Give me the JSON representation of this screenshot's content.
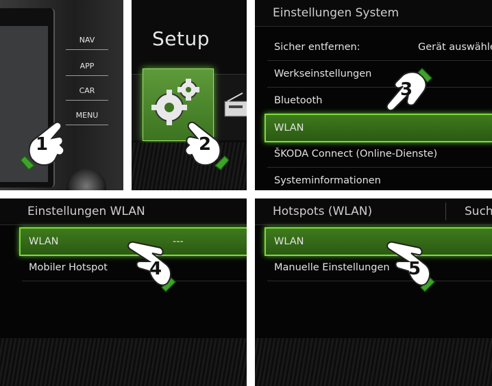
{
  "panel_dashboard": {
    "buttons": [
      "NAV",
      "APP",
      "CAR",
      "MENU"
    ],
    "step": "1"
  },
  "panel_setup": {
    "title": "Setup",
    "step": "2"
  },
  "panel_system": {
    "title": "Einstellungen System",
    "rows": [
      {
        "label": "Sicher entfernen:",
        "value": "Gerät auswähle"
      },
      {
        "label": "Werkseinstellungen"
      },
      {
        "label": "Bluetooth"
      },
      {
        "label": "WLAN",
        "selected": true
      },
      {
        "label": "ŠKODA Connect (Online-Dienste)"
      },
      {
        "label": "Systeminformationen"
      }
    ],
    "step": "3"
  },
  "panel_wlan": {
    "title": "Einstellungen WLAN",
    "rows": [
      {
        "label": "WLAN",
        "value": "---",
        "selected": true
      },
      {
        "label": "Mobiler Hotspot"
      }
    ],
    "step": "4"
  },
  "panel_hotspots": {
    "title": "Hotspots (WLAN)",
    "title_action": "Such",
    "rows": [
      {
        "label": "WLAN",
        "selected": true
      },
      {
        "label": "Manuelle Einstellungen"
      }
    ],
    "step": "5"
  },
  "colors": {
    "highlight_green": "#3f7a1e",
    "highlight_border": "#7ddc3a",
    "hand_green": "#3fa32a"
  },
  "icons": [
    "gear-icon",
    "radio-icon",
    "hand-pointer-icon"
  ]
}
